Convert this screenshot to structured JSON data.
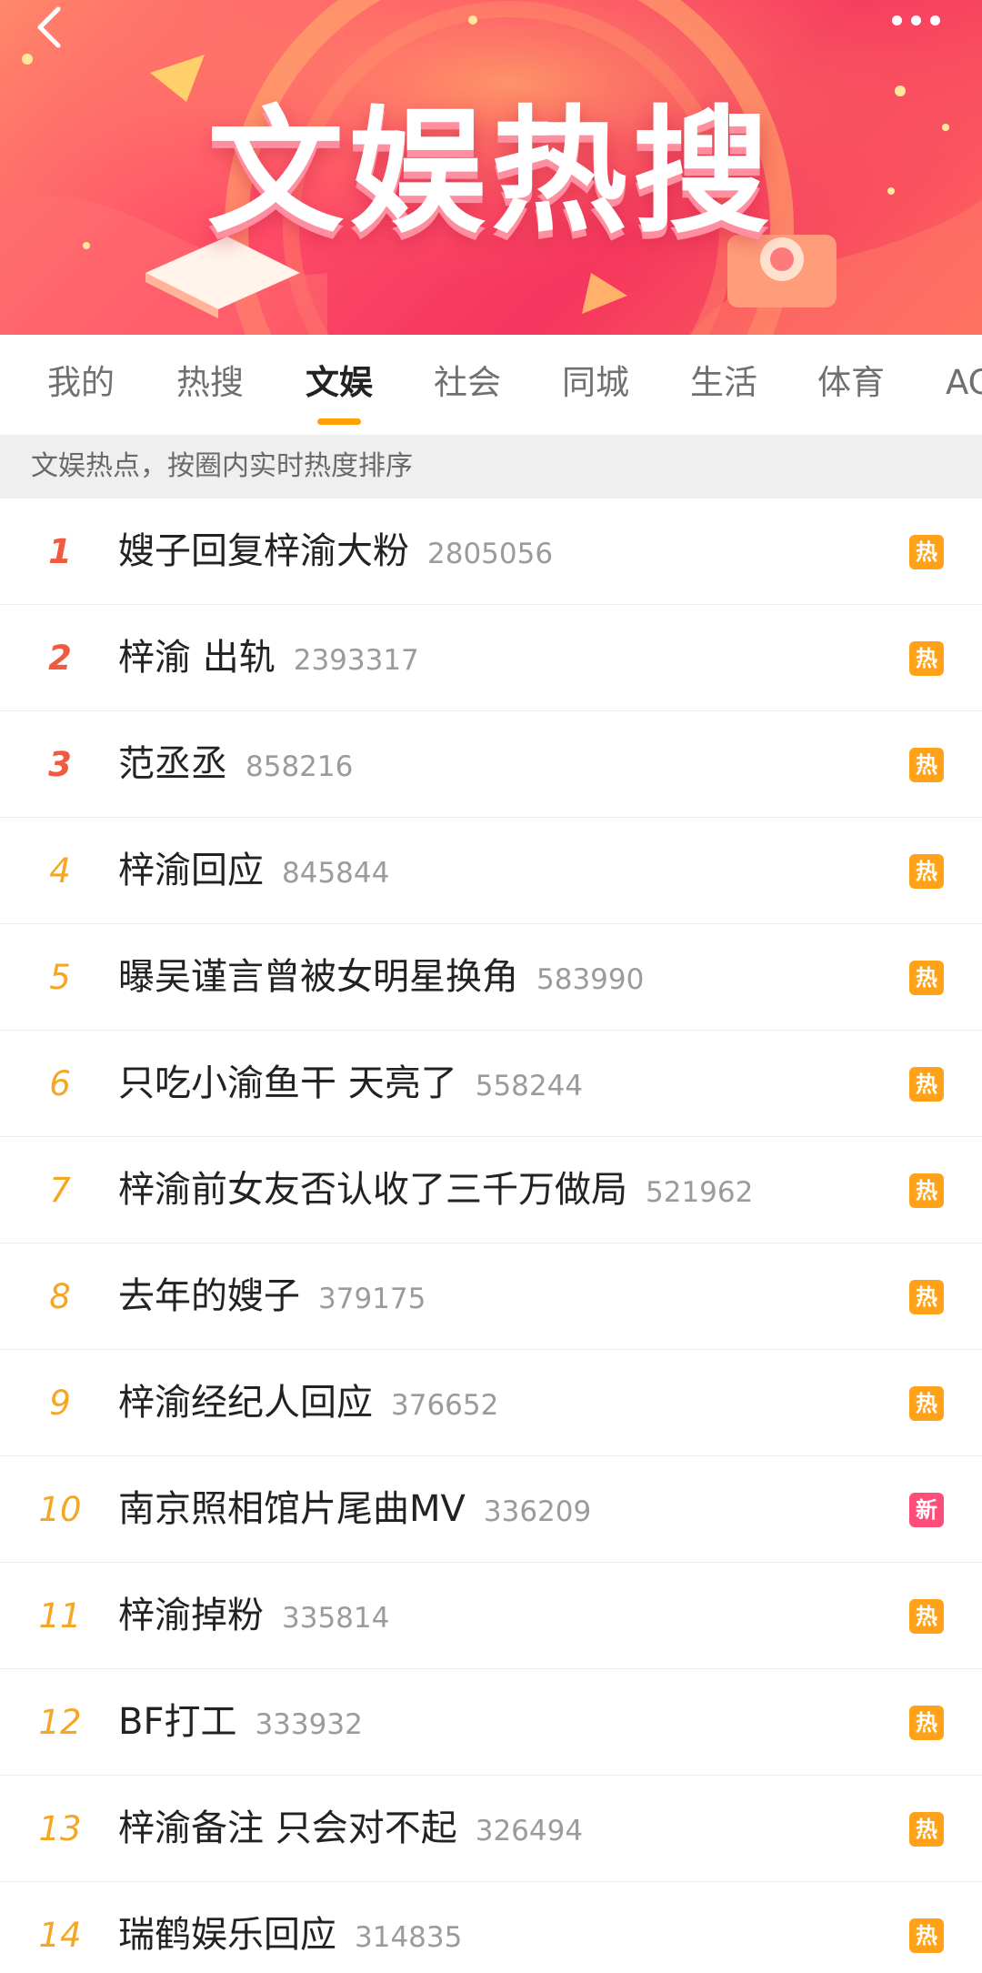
{
  "banner": {
    "title": "文娱热搜",
    "colors": {
      "accent": "#ffa100",
      "banner_pink": "#f5355e",
      "banner_orange": "#ff8a6b"
    }
  },
  "icons": {
    "back": "chevron-left-icon",
    "more": "more-dots-icon"
  },
  "tabs": [
    {
      "label": "我的",
      "active": false
    },
    {
      "label": "热搜",
      "active": false
    },
    {
      "label": "文娱",
      "active": true
    },
    {
      "label": "社会",
      "active": false
    },
    {
      "label": "同城",
      "active": false
    },
    {
      "label": "生活",
      "active": false
    },
    {
      "label": "体育",
      "active": false
    },
    {
      "label": "AC",
      "active": false
    }
  ],
  "subheader": {
    "text": "文娱热点，按圈内实时热度排序"
  },
  "items": [
    {
      "rank": "1",
      "title": "嫂子回复梓渝大粉",
      "count": "2805056",
      "badge": "热"
    },
    {
      "rank": "2",
      "title": "梓渝 出轨",
      "count": "2393317",
      "badge": "热"
    },
    {
      "rank": "3",
      "title": "范丞丞",
      "count": "858216",
      "badge": "热"
    },
    {
      "rank": "4",
      "title": "梓渝回应",
      "count": "845844",
      "badge": "热"
    },
    {
      "rank": "5",
      "title": "曝吴谨言曾被女明星换角",
      "count": "583990",
      "badge": "热"
    },
    {
      "rank": "6",
      "title": "只吃小渝鱼干 天亮了",
      "count": "558244",
      "badge": "热"
    },
    {
      "rank": "7",
      "title": "梓渝前女友否认收了三千万做局",
      "count": "521962",
      "badge": "热"
    },
    {
      "rank": "8",
      "title": "去年的嫂子",
      "count": "379175",
      "badge": "热"
    },
    {
      "rank": "9",
      "title": "梓渝经纪人回应",
      "count": "376652",
      "badge": "热"
    },
    {
      "rank": "10",
      "title": "南京照相馆片尾曲MV",
      "count": "336209",
      "badge": "新"
    },
    {
      "rank": "11",
      "title": "梓渝掉粉",
      "count": "335814",
      "badge": "热"
    },
    {
      "rank": "12",
      "title": "BF打工",
      "count": "333932",
      "badge": "热"
    },
    {
      "rank": "13",
      "title": "梓渝备注 只会对不起",
      "count": "326494",
      "badge": "热"
    },
    {
      "rank": "14",
      "title": "瑞鹤娱乐回应",
      "count": "314835",
      "badge": "热"
    }
  ]
}
